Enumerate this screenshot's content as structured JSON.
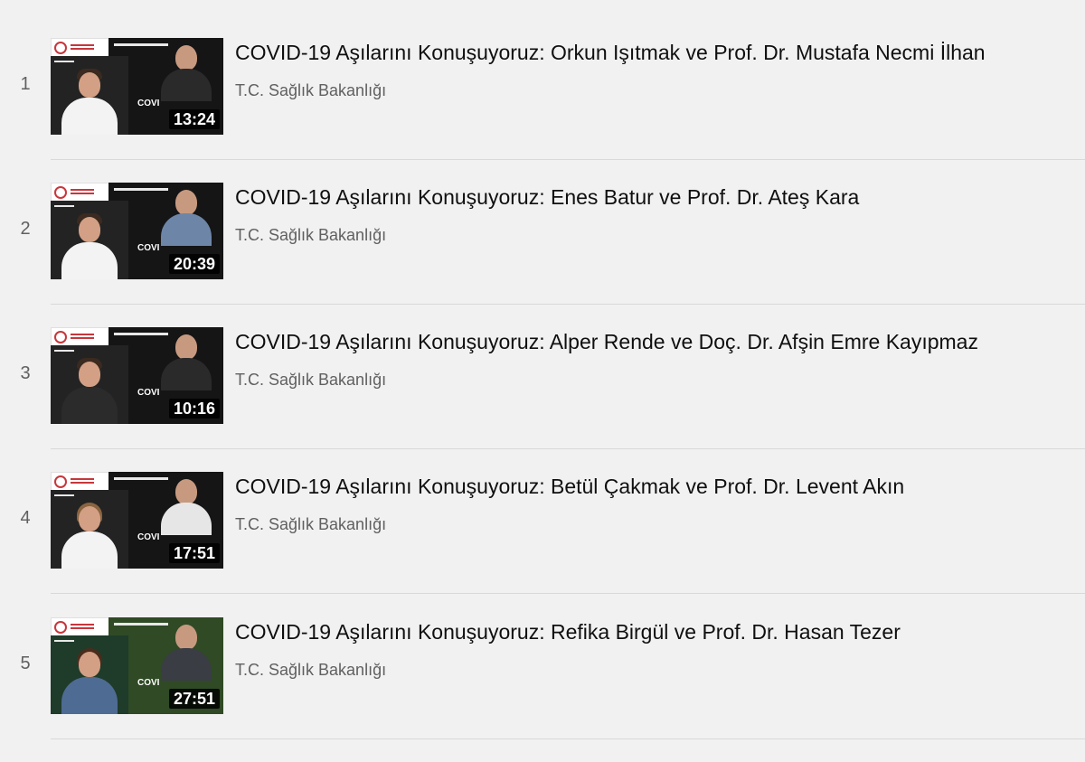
{
  "playlist": {
    "items": [
      {
        "index": "1",
        "title": "COVID-19 Aşılarını Konuşuyoruz: Orkun Işıtmak ve Prof. Dr. Mustafa Necmi İlhan",
        "channel": "T.C. Sağlık Bakanlığı",
        "duration": "13:24",
        "thumb_covid_text": "COVI"
      },
      {
        "index": "2",
        "title": "COVID-19 Aşılarını Konuşuyoruz: Enes Batur ve Prof. Dr. Ateş Kara",
        "channel": "T.C. Sağlık Bakanlığı",
        "duration": "20:39",
        "thumb_covid_text": "COVI"
      },
      {
        "index": "3",
        "title": "COVID-19 Aşılarını Konuşuyoruz: Alper Rende ve Doç. Dr. Afşin Emre Kayıpmaz",
        "channel": "T.C. Sağlık Bakanlığı",
        "duration": "10:16",
        "thumb_covid_text": "COVI"
      },
      {
        "index": "4",
        "title": "COVID-19 Aşılarını Konuşuyoruz: Betül Çakmak ve Prof. Dr. Levent Akın",
        "channel": "T.C. Sağlık Bakanlığı",
        "duration": "17:51",
        "thumb_covid_text": "COVI"
      },
      {
        "index": "5",
        "title": "COVID-19 Aşılarını Konuşuyoruz: Refika Birgül ve Prof. Dr. Hasan Tezer",
        "channel": "T.C. Sağlık Bakanlığı",
        "duration": "27:51",
        "thumb_covid_text": "COVI"
      }
    ]
  },
  "colors": {
    "background": "#f1f1f1",
    "title_text": "#0f0f0f",
    "secondary_text": "#606060",
    "brand_red": "#c6373c"
  }
}
